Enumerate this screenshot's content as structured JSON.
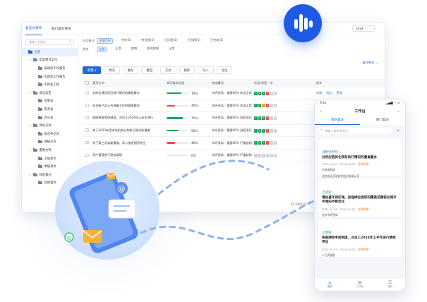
{
  "topbar": {
    "tabs": [
      "督查办事项",
      "部门督办事项"
    ],
    "year": "2024"
  },
  "sidebar": {
    "search_placeholder": "请输入关键字",
    "items": [
      {
        "label": "全部",
        "level": 0,
        "arrow": "",
        "selected": true
      },
      {
        "label": "年度重点工作",
        "level": 1,
        "arrow": "▾",
        "selected": false
      },
      {
        "label": "省政府工作报告",
        "level": 2,
        "arrow": "",
        "selected": false
      },
      {
        "label": "市政府工作报告",
        "level": 2,
        "arrow": "",
        "selected": false
      },
      {
        "label": "市民生工程",
        "level": 2,
        "arrow": "",
        "selected": false
      },
      {
        "label": "会议议定",
        "level": 1,
        "arrow": "▾",
        "selected": false
      },
      {
        "label": "常委会",
        "level": 2,
        "arrow": "",
        "selected": false
      },
      {
        "label": "常务会",
        "level": 2,
        "arrow": "",
        "selected": false
      },
      {
        "label": "办公会",
        "level": 2,
        "arrow": "",
        "selected": false
      },
      {
        "label": "领导交办",
        "level": 1,
        "arrow": "▾",
        "selected": false
      },
      {
        "label": "批示件交办",
        "level": 2,
        "arrow": "",
        "selected": false
      },
      {
        "label": "调研交办",
        "level": 2,
        "arrow": "",
        "selected": false
      },
      {
        "label": "重要文件",
        "level": 1,
        "arrow": "▾",
        "selected": false
      },
      {
        "label": "上级来文",
        "level": 2,
        "arrow": "",
        "selected": false
      },
      {
        "label": "本级来文",
        "level": 2,
        "arrow": "",
        "selected": false
      },
      {
        "label": "其他督办",
        "level": 1,
        "arrow": "▸",
        "selected": false
      },
      {
        "label": "其他督办",
        "level": 2,
        "arrow": "",
        "selected": false
      }
    ]
  },
  "filters": {
    "row1_label": "节点概况",
    "row1": [
      "全部(58)",
      "待办(5)",
      "待处理(5)",
      "已反馈(5)",
      "已办理(5)",
      "已完成(5)"
    ],
    "row2_label": "状态",
    "row2": [
      "全部",
      "正常",
      "超期",
      "即将超期",
      "正常"
    ],
    "expand": "展开更多 ⌄"
  },
  "toolbar": [
    "新建 ▾",
    "情况",
    "催办",
    "撤回",
    "交办",
    "删除",
    "导入",
    "导出"
  ],
  "table": {
    "headers": [
      "事项名称",
      "事项最新进展",
      "完成情况",
      "阶段/调度一览",
      "操作"
    ],
    "rows": [
      {
        "name": "对岗位建设项目执行情况的督查督办",
        "pct": "70%",
        "progress": 70,
        "color": "#18a058",
        "status": "市环保局：重量60% 状态正常",
        "stages": [
          "#18a058",
          "#18a058",
          "#18a058",
          "#e74c3c",
          "#c8ced6",
          "#c8ced6"
        ],
        "actions": [
          "办结",
          "终止",
          "更多"
        ]
      },
      {
        "name": "针对新产品上市准备工作的督查督办",
        "pct": "40%",
        "progress": 40,
        "color": "#e74c3c",
        "status": "市环保局：重量60% 状态正常",
        "stages": [
          "#18a058",
          "#18a058",
          "#f0a020",
          "#e74c3c",
          "#c8ced6",
          "#c8ced6"
        ],
        "actions": [
          "办结",
          "终止",
          "更多"
        ]
      },
      {
        "name": "按照绩效考核制度，对员工2024年上半年进行",
        "pct": "75%",
        "progress": 75,
        "color": "#18a058",
        "status": "市环保局：重量60% 进度滞后",
        "stages": [
          "#18a058",
          "#18a058",
          "#18a058",
          "#e74c3c",
          "#c8ced6",
          "#c8ced6"
        ],
        "actions": [
          "办结",
          "终止",
          "更多"
        ]
      },
      {
        "name": "关于2023年度市场机构计划执行情况的督查",
        "pct": "55%",
        "progress": 55,
        "color": "#18a058",
        "status": "市环保局：重量60% 进度滞后",
        "stages": [
          "#18a058",
          "#18a058",
          "#18a058",
          "#e74c3c",
          "#c8ced6",
          "#c8ced6"
        ],
        "actions": [
          "办结",
          "终止",
          "更多"
        ]
      },
      {
        "name": "关于第三次省委督查，深入推进国资央企",
        "pct": "40%",
        "progress": 40,
        "color": "#e74c3c",
        "status": "市环保局：重量60% 严重超期",
        "stages": [
          "#18a058",
          "#18a058",
          "#18a058",
          "#e74c3c",
          "#c8ced6",
          "#c8ced6"
        ],
        "actions": [
          "办结",
          "终止",
          "更多"
        ]
      },
      {
        "name": "资产管理关于财务管理",
        "pct": "0%",
        "progress": 0,
        "color": "#c8ced6",
        "status": "市环保局：重量60% 严重超期",
        "stages": [
          "#c8ced6",
          "#c8ced6",
          "#c8ced6",
          "#c8ced6",
          "#c8ced6",
          "#c8ced6"
        ],
        "actions": [
          "办结",
          "终止",
          "更多"
        ]
      }
    ]
  },
  "pager": {
    "total": "共 1000 项",
    "pages": [
      "‹",
      "1",
      "···",
      "4",
      "5",
      "6",
      "›"
    ],
    "current": "6"
  },
  "mobile": {
    "time": "9:41",
    "signal": "▂▄▆ ◠ ▭",
    "title": "工作台",
    "back": "‹",
    "more": "···",
    "tabs": [
      "我的督办",
      "部门督办"
    ],
    "search_placeholder": "请输入搜索关键字",
    "filter_icon": "⏷",
    "cards": [
      {
        "tag": "进行中 80%",
        "tag_color": "#1f6bd6",
        "tag_bg": "#e6effc",
        "title": "对供应链优化项目执行情况的督查督办",
        "date": "2021.04.25 - 2022.04.25",
        "flag": "即将超期",
        "dept": "市场采购部",
        "org": "北京致远互联软件股份有限公司"
      },
      {
        "tag": "已办结",
        "tag_color": "#18a058",
        "tag_bg": "#e7f6ed",
        "title": "增加基环保区域。加强绿化面积的覆盖范围保证城市环境的不断优化",
        "date": "2021.04.25 - 2022.04.25",
        "flag": "即将超期",
        "dept": "北京市环保局",
        "org": ""
      },
      {
        "tag": "已办结",
        "tag_color": "#18a058",
        "tag_bg": "#e7f6ed",
        "title": "按照绩效考核制度，对员工2024年上半年进行绩效评估",
        "date": "2021.04.25 - 2022.04.25",
        "flag": "即将超期",
        "dept": "人力资源部",
        "org": ""
      }
    ],
    "nav": [
      {
        "label": "首页",
        "icon": "⌂",
        "active": true
      },
      {
        "label": "工作台",
        "icon": "▤",
        "active": false
      },
      {
        "label": "我的",
        "icon": "☰",
        "active": false
      }
    ]
  },
  "colors": {
    "accent": "#1f6bd6",
    "logo": "#1e5ae6",
    "ok": "#18a058",
    "warn": "#e74c3c"
  }
}
